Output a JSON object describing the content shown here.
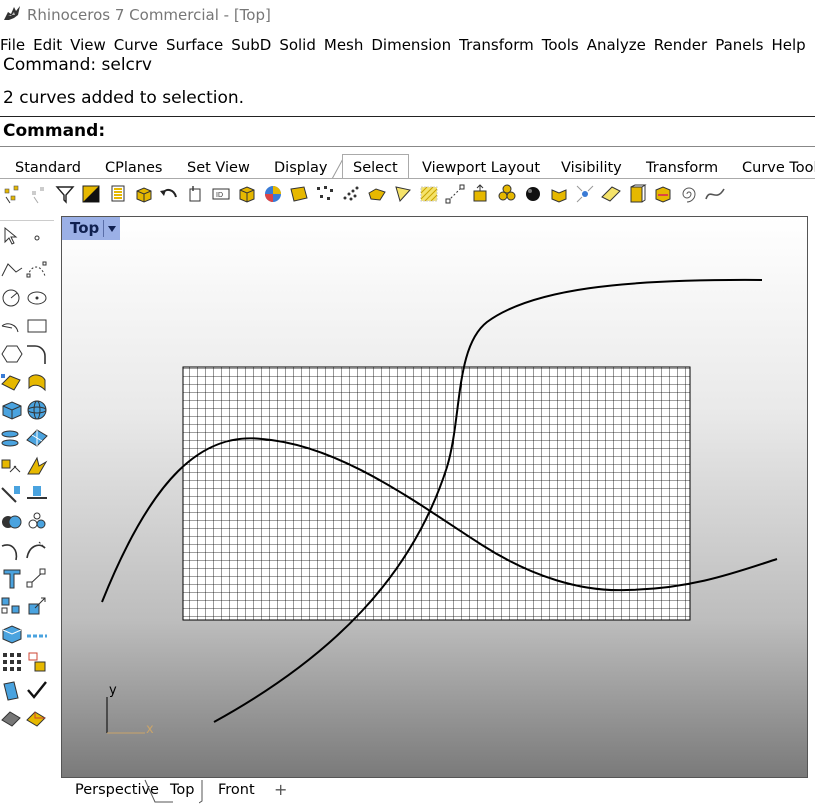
{
  "window": {
    "title": "Rhinoceros 7 Commercial - [Top]"
  },
  "menu": [
    "File",
    "Edit",
    "View",
    "Curve",
    "Surface",
    "SubD",
    "Solid",
    "Mesh",
    "Dimension",
    "Transform",
    "Tools",
    "Analyze",
    "Render",
    "Panels",
    "Help"
  ],
  "command": {
    "history": [
      "Command: selcrv",
      "2 curves added to selection."
    ],
    "prompt": "Command:"
  },
  "toolbar_tabs": {
    "items": [
      "Standard",
      "CPlanes",
      "Set View",
      "Display",
      "Select",
      "Viewport Layout",
      "Visibility",
      "Transform",
      "Curve Tools"
    ],
    "active": "Select"
  },
  "viewport": {
    "name": "Top",
    "axis_labels": {
      "y": "y",
      "x": "x"
    }
  },
  "viewport_tabs": {
    "items": [
      "Perspective",
      "Top",
      "Front"
    ],
    "active": "Top",
    "add_label": "+"
  },
  "colors": {
    "accent": "#9bb0e6",
    "axis_x": "#c9a46a",
    "axis_y": "#000000",
    "grid_line": "#000000"
  }
}
